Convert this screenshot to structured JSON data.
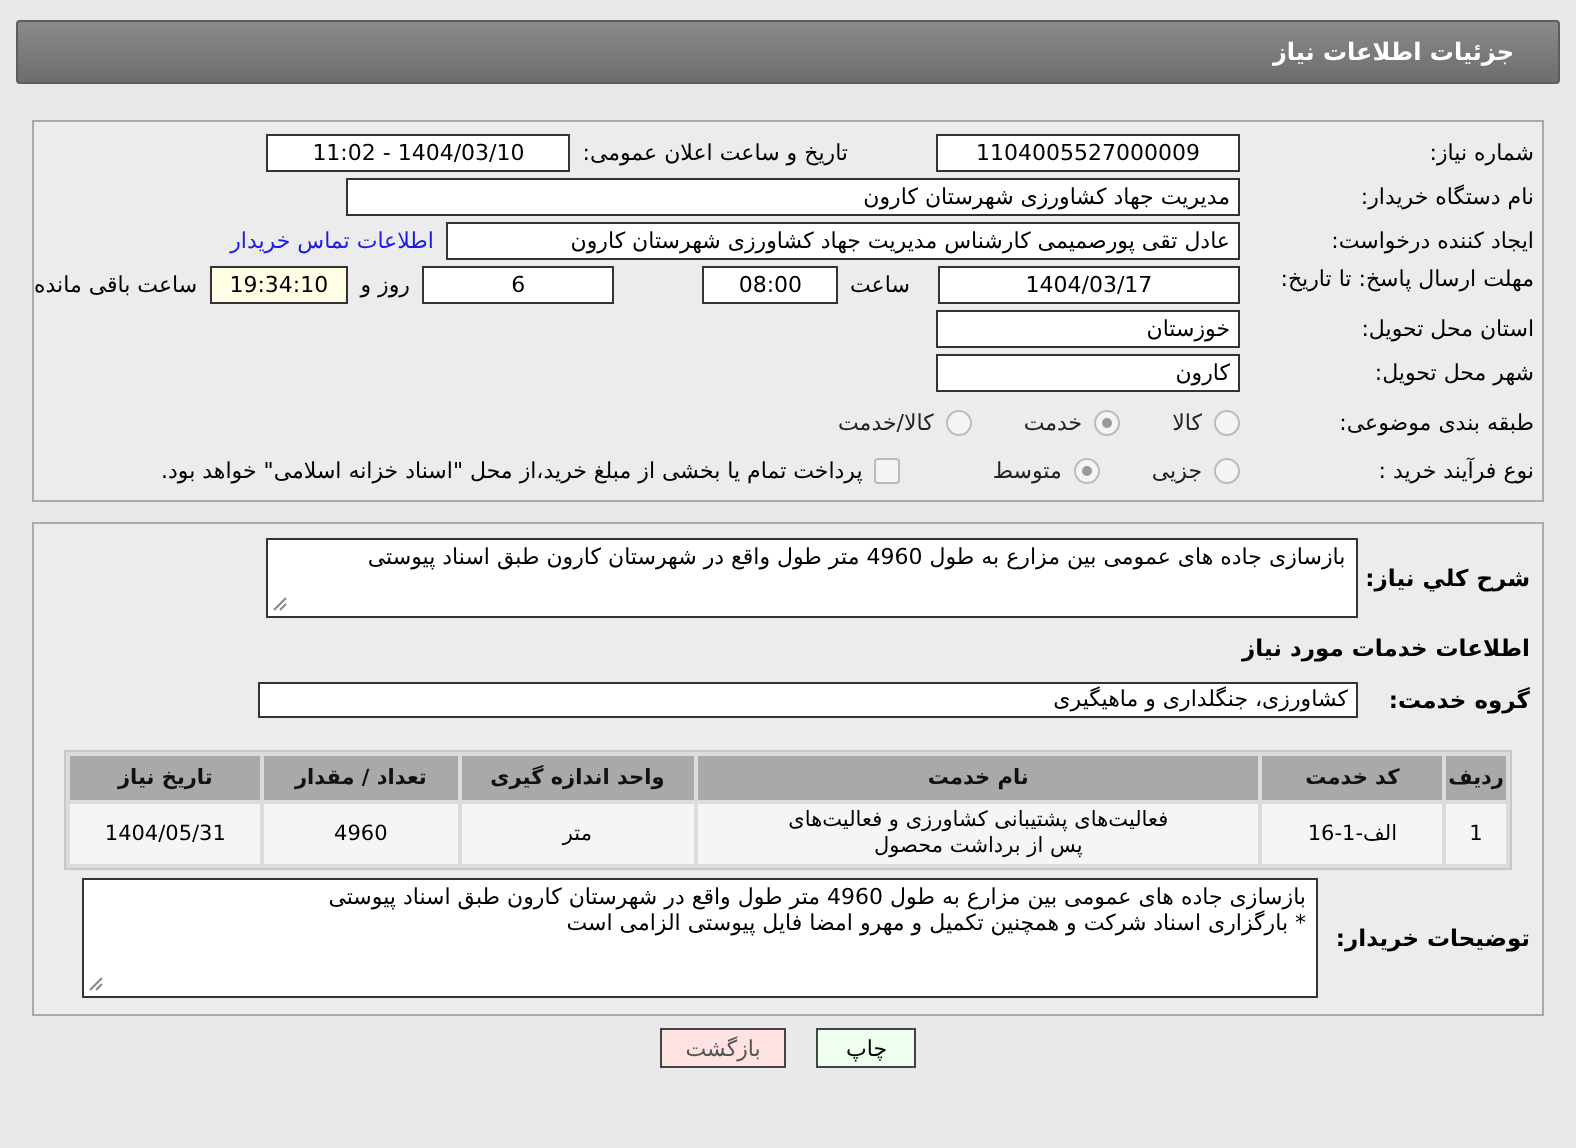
{
  "header": {
    "title": "جزئیات اطلاعات نیاز"
  },
  "details": {
    "need_number": {
      "label": "شماره نیاز:",
      "value": "1104005527000009"
    },
    "announce": {
      "label": "تاریخ و ساعت اعلان عمومی:",
      "value": "1404/03/10 - 11:02"
    },
    "buyer_org": {
      "label": "نام دستگاه خریدار:",
      "value": "مدیریت جهاد کشاورزی شهرستان کارون"
    },
    "requester": {
      "label": "ایجاد کننده درخواست:",
      "value": "عادل تقی پورصمیمی کارشناس مدیریت جهاد کشاورزی شهرستان کارون",
      "link": "اطلاعات تماس خریدار"
    },
    "deadline": {
      "label": "مهلت ارسال پاسخ: تا تاریخ:",
      "date": "1404/03/17",
      "time_label": "ساعت",
      "time": "08:00",
      "days": "6",
      "days_label": "روز و",
      "remaining": "19:34:10",
      "remaining_label": "ساعت باقی مانده"
    },
    "province": {
      "label": "استان محل تحویل:",
      "value": "خوزستان"
    },
    "city": {
      "label": "شهر محل تحویل:",
      "value": "کارون"
    },
    "category": {
      "label": "طبقه بندی موضوعی:",
      "options": [
        {
          "label": "کالا",
          "selected": false,
          "disabled": true
        },
        {
          "label": "خدمت",
          "selected": true,
          "disabled": true
        },
        {
          "label": "کالا/خدمت",
          "selected": false,
          "disabled": true
        }
      ]
    },
    "process": {
      "label": "نوع فرآیند خرید :",
      "options": [
        {
          "label": "جزیی",
          "selected": false,
          "disabled": true
        },
        {
          "label": "متوسط",
          "selected": true,
          "disabled": true
        }
      ],
      "payment": {
        "label": "پرداخت تمام یا بخشی از مبلغ خرید،از محل \"اسناد خزانه اسلامی\" خواهد بود.",
        "checked": false
      }
    }
  },
  "services": {
    "description": {
      "label": "شرح کلي نياز:",
      "value": "بازسازی جاده های عمومی بین مزارع به طول 4960 متر طول واقع در شهرستان کارون طبق اسناد پیوستی"
    },
    "heading": "اطلاعات خدمات مورد نیاز",
    "group": {
      "label": "گروه خدمت:",
      "value": "کشاورزی، جنگلداری و ماهیگیری"
    },
    "table": {
      "columns": [
        "ردیف",
        "کد خدمت",
        "نام خدمت",
        "واحد اندازه گیری",
        "تعداد / مقدار",
        "تاریخ نیاز"
      ],
      "rows": [
        [
          "1",
          "الف-1-16",
          "فعالیت‌های پشتیبانی کشاورزی و فعالیت‌های پس از برداشت محصول",
          "متر",
          "4960",
          "1404/05/31"
        ]
      ]
    },
    "notes": {
      "label": "توضیحات خریدار:",
      "value": "بازسازی جاده های عمومی بین مزارع به طول 4960 متر طول واقع در شهرستان کارون طبق اسناد پیوستی\n* بارگزاری اسناد شرکت و همچنین تکمیل و  مهرو امضا فایل پیوستی الزامی است"
    }
  },
  "buttons": [
    {
      "label": "چاپ",
      "kind": "print"
    },
    {
      "label": "بازگشت",
      "kind": "back"
    }
  ]
}
